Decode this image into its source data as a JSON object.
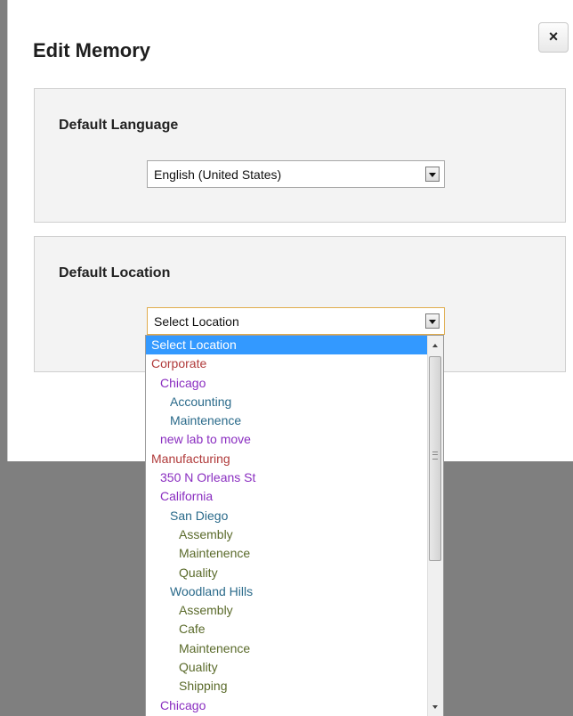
{
  "dialog": {
    "title": "Edit Memory",
    "close_label": "×"
  },
  "language_section": {
    "label": "Default Language",
    "selected": "English (United States)"
  },
  "location_section": {
    "label": "Default Location",
    "selected": "Select Location"
  },
  "colors": {
    "backdrop": "#7f7f7f",
    "highlight": "#3399ff",
    "level_0": "#b03a3a",
    "level_1": "#8a2ec0",
    "level_2": "#2a6a8a",
    "level_3": "#5a6a2a"
  },
  "dropdown": {
    "options": [
      {
        "label": "Select Location",
        "level": 0,
        "selected": true
      },
      {
        "label": "Corporate",
        "level": 0
      },
      {
        "label": "Chicago",
        "level": 1
      },
      {
        "label": "Accounting",
        "level": 2
      },
      {
        "label": "Maintenence",
        "level": 2
      },
      {
        "label": "new lab to move",
        "level": 1
      },
      {
        "label": "Manufacturing",
        "level": 0
      },
      {
        "label": "350 N Orleans St",
        "level": 1
      },
      {
        "label": "California",
        "level": 1
      },
      {
        "label": "San Diego",
        "level": 2
      },
      {
        "label": "Assembly",
        "level": 3
      },
      {
        "label": "Maintenence",
        "level": 3
      },
      {
        "label": "Quality",
        "level": 3
      },
      {
        "label": "Woodland Hills",
        "level": 2
      },
      {
        "label": "Assembly",
        "level": 3
      },
      {
        "label": "Cafe",
        "level": 3
      },
      {
        "label": "Maintenence",
        "level": 3
      },
      {
        "label": "Quality",
        "level": 3
      },
      {
        "label": "Shipping",
        "level": 3
      },
      {
        "label": "Chicago",
        "level": 1
      }
    ]
  }
}
